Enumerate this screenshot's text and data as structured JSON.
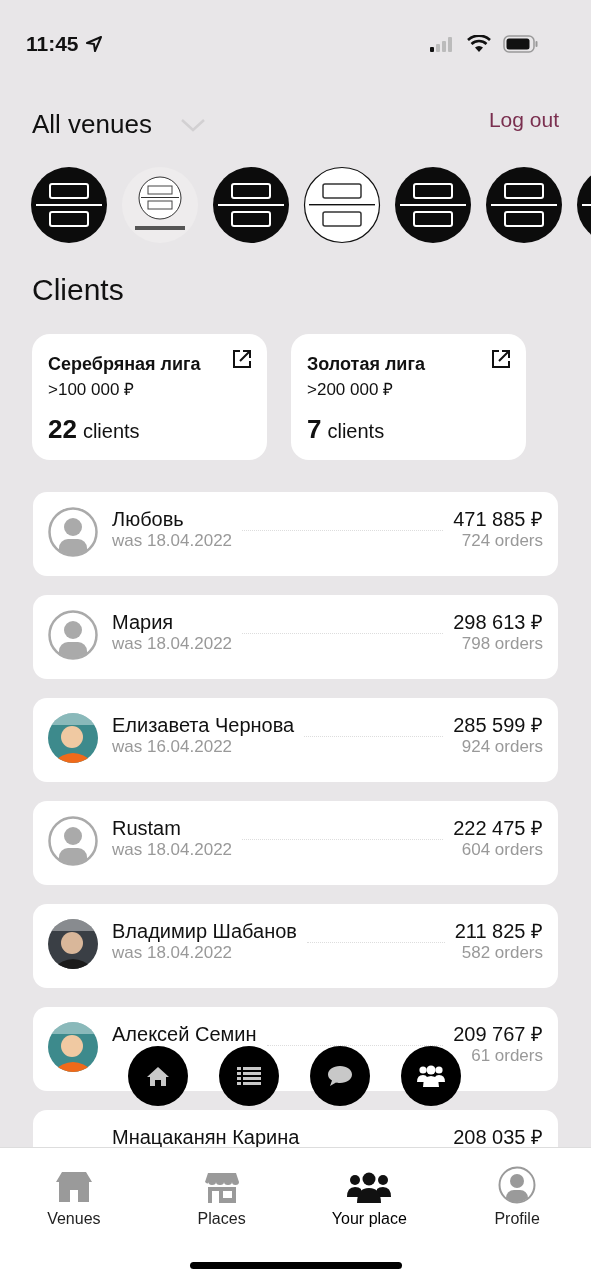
{
  "status_bar": {
    "time": "11:45"
  },
  "header": {
    "title": "All venues",
    "logout": "Log out"
  },
  "venues": [
    {
      "kind": "dark"
    },
    {
      "kind": "small"
    },
    {
      "kind": "dark"
    },
    {
      "kind": "light"
    },
    {
      "kind": "dark"
    },
    {
      "kind": "dark"
    },
    {
      "kind": "dark"
    }
  ],
  "section_title": "Clients",
  "segments": [
    {
      "title": "Серебряная лига",
      "threshold": ">100 000 ₽",
      "count": "22",
      "unit": "clients"
    },
    {
      "title": "Золотая лига",
      "threshold": ">200 000 ₽",
      "count": "7",
      "unit": "clients"
    }
  ],
  "clients": [
    {
      "name": "Любовь",
      "last_seen": "was 18.04.2022",
      "amount": "471 885 ₽",
      "orders": "724 orders",
      "avatar": {
        "kind": "default"
      }
    },
    {
      "name": "Мария",
      "last_seen": "was 18.04.2022",
      "amount": "298 613 ₽",
      "orders": "798 orders",
      "avatar": {
        "kind": "default"
      }
    },
    {
      "name": "Елизавета Чернова",
      "last_seen": "was 16.04.2022",
      "amount": "285 599 ₽",
      "orders": "924 orders"
    },
    {
      "name": "Rustam",
      "last_seen": "was 18.04.2022",
      "amount": "222 475 ₽",
      "orders": "604 orders",
      "avatar": {
        "kind": "default"
      }
    },
    {
      "name": "Владимир Шабанов",
      "last_seen": "was 18.04.2022",
      "amount": "211 825 ₽",
      "orders": "582 orders"
    },
    {
      "name": "Алексей Семин",
      "amount": "209 767 ₽",
      "orders": "61 orders"
    },
    {
      "name": "Мнацаканян Карина",
      "amount": "208 035 ₽"
    }
  ],
  "fab_buttons": [
    {
      "kind": "home"
    },
    {
      "kind": "list"
    },
    {
      "kind": "chat"
    },
    {
      "kind": "group"
    }
  ],
  "tabs": [
    {
      "label": "Venues",
      "kind": "house",
      "selected": false
    },
    {
      "label": "Places",
      "kind": "store",
      "selected": false
    },
    {
      "label": "Your place",
      "kind": "group",
      "selected": true
    },
    {
      "label": "Profile",
      "kind": "person",
      "selected": false
    }
  ]
}
